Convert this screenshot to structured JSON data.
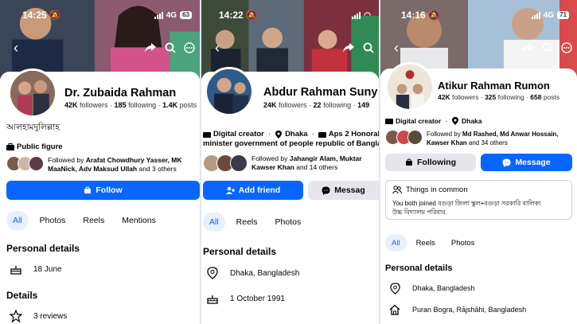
{
  "screens": [
    {
      "time": "14:25",
      "network": "4G",
      "battery": "63",
      "name": "Dr. Zubaida Rahman",
      "followers": "42K",
      "followers_label": "followers",
      "following": "185",
      "following_label": "following",
      "likes": "1.4K",
      "likes_label": "posts",
      "bio": "আলহামদুলিল্লাহ",
      "category": "Public figure",
      "followed_by_prefix": "Followed by ",
      "followed_by_names": "Arafat Chowdhury Yasser, MK",
      "followed_by_line2": "MaaNick, Adv Maksud Ullah",
      "followed_by_suffix": " and 3 others",
      "primary_button": "Follow",
      "tabs": [
        "All",
        "Photos",
        "Reels",
        "Mentions"
      ],
      "personal_details_title": "Personal details",
      "birthday": "18 June",
      "details_title": "Details",
      "reviews": "3 reviews"
    },
    {
      "time": "14:22",
      "network": "",
      "battery": "",
      "name": "Abdur Rahman Suny",
      "followers": "24K",
      "followers_label": "followers",
      "following": "22",
      "following_label": "following",
      "likes": "149",
      "category": "Digital creator",
      "location": "Dhaka",
      "work_line1": "Aps 2 Honorable",
      "work_line2": "minister government of people republic of Banglade",
      "followed_by_prefix": "Followed by ",
      "followed_by_names": "Jahangir Alam, Muktar",
      "followed_by_line2": "Kawser Khan",
      "followed_by_suffix": " and 14 others",
      "primary_button": "Add friend",
      "secondary_button": "Messag",
      "tabs": [
        "All",
        "Reels",
        "Photos"
      ],
      "personal_details_title": "Personal details",
      "city": "Dhaka, Bangladesh",
      "birthday": "1 October 1991"
    },
    {
      "time": "14:16",
      "network": "4G",
      "battery": "71",
      "name": "Atikur Rahman Rumon",
      "followers": "42K",
      "followers_label": "followers",
      "following": "325",
      "following_label": "following",
      "likes": "658",
      "likes_label": "posts",
      "category": "Digital creator",
      "location": "Dhaka",
      "followed_by_prefix": "Followed by ",
      "followed_by_names": "Md Rashed, Md Anwar Hossain,",
      "followed_by_line2": "Kawser Khan",
      "followed_by_suffix": " and 34 others",
      "primary_button": "Following",
      "secondary_button": "Message",
      "common_title": "Things in common",
      "common_text_line1": "You both joined বগুড়া জিলা স্কুল+বগুড়া সরকারি বালিকা",
      "common_text_line2": "উচ্চ বিদ্যালয় পরিবার.",
      "tabs": [
        "All",
        "Reels",
        "Photos"
      ],
      "personal_details_title": "Personal details",
      "city": "Dhaka, Bangladesh",
      "hometown": "Puran Bogra, Rājshāhi, Bangladesh"
    }
  ],
  "colors": {
    "accent": "#0866ff",
    "tab_active_bg": "#e7f0fd",
    "secondary_btn": "#e4e6eb"
  }
}
